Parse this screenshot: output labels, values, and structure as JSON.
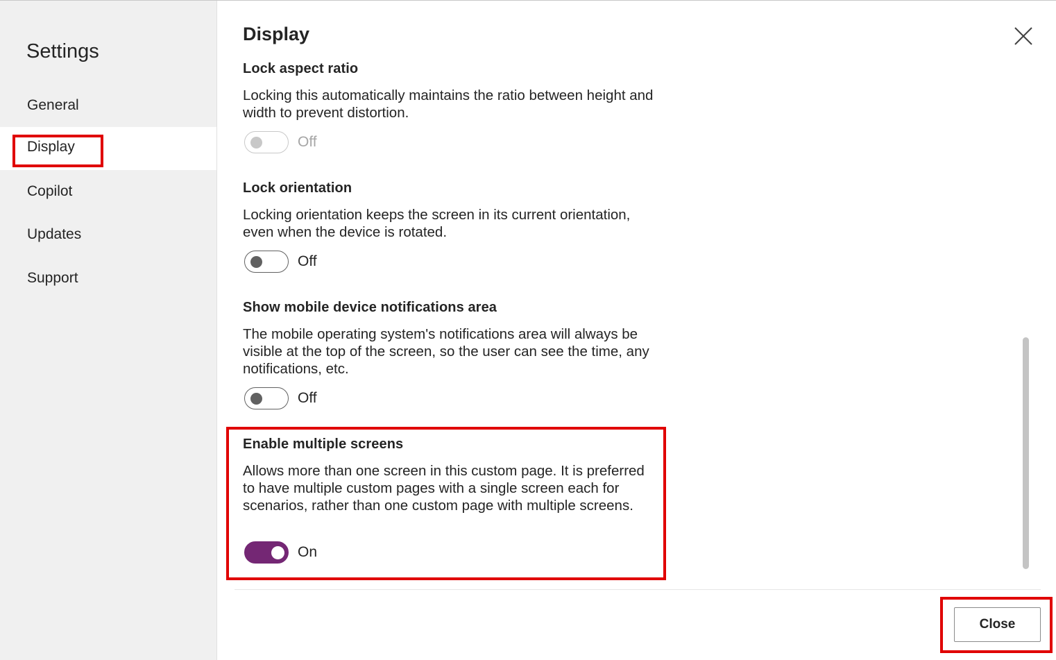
{
  "sidebar": {
    "title": "Settings",
    "items": [
      {
        "label": "General"
      },
      {
        "label": "Display"
      },
      {
        "label": "Copilot"
      },
      {
        "label": "Updates"
      },
      {
        "label": "Support"
      }
    ],
    "selected": "Display"
  },
  "main": {
    "title": "Display",
    "settings": [
      {
        "title": "Lock aspect ratio",
        "description": "Locking this automatically maintains the ratio between height and width to prevent distortion.",
        "state": "Off",
        "enabled": false
      },
      {
        "title": "Lock orientation",
        "description": "Locking orientation keeps the screen in its current orientation, even when the device is rotated.",
        "state": "Off",
        "enabled": true
      },
      {
        "title": "Show mobile device notifications area",
        "description": "The mobile operating system's notifications area will always be visible at the top of the screen, so the user can see the time, any notifications, etc.",
        "state": "Off",
        "enabled": true
      },
      {
        "title": "Enable multiple screens",
        "description": "Allows more than one screen in this custom page. It is preferred to have multiple custom pages with a single screen each for scenarios, rather than one custom page with multiple screens.",
        "state": "On",
        "enabled": true
      }
    ]
  },
  "footer": {
    "close_label": "Close"
  },
  "icons": {
    "dismiss": "close-icon"
  },
  "colors": {
    "accent": "#742774",
    "highlight": "#e00000",
    "sidebar_bg": "#f0f0f0"
  }
}
